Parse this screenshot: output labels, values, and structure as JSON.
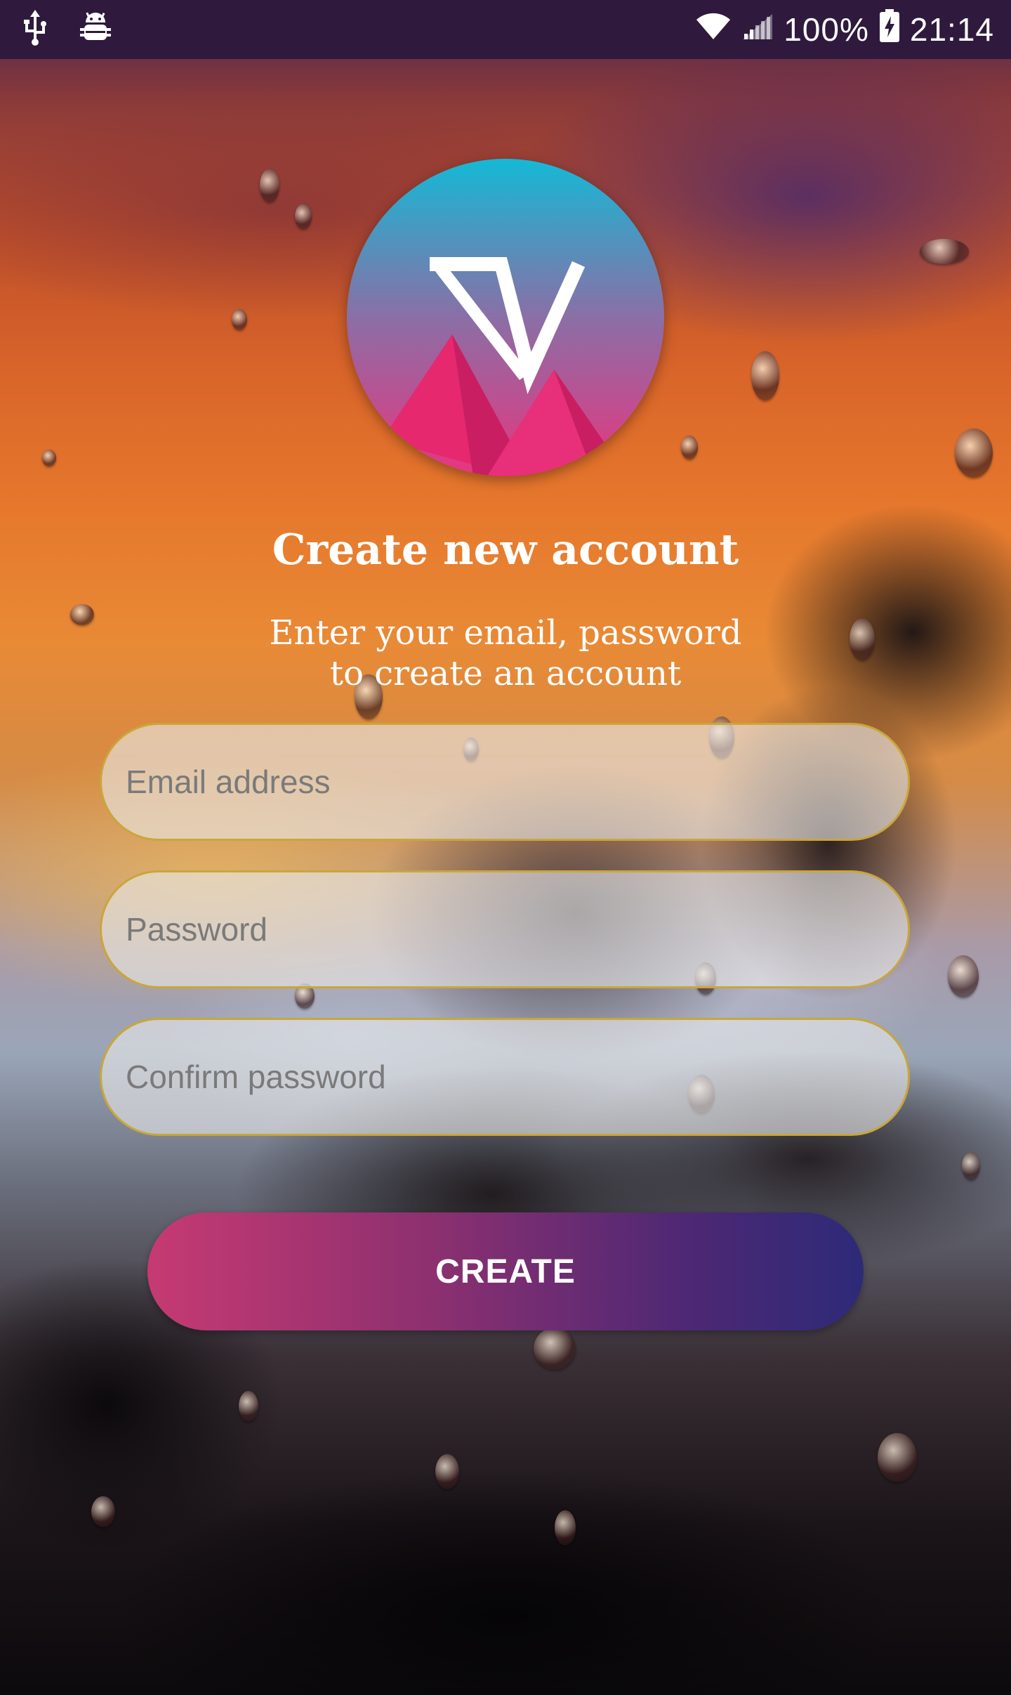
{
  "status_bar": {
    "battery": "100%",
    "time": "21:14",
    "icons": [
      "usb-icon",
      "android-debug-icon",
      "wifi-icon",
      "signal-icon",
      "battery-charging-icon"
    ]
  },
  "logo": {
    "icon": "app-logo-icon",
    "colors": {
      "gradient_top": "#14b9d6",
      "gradient_bottom": "#e8357f",
      "mountain": "#e6286f"
    }
  },
  "header": {
    "title": "Create new account",
    "subtitle_line1": "Enter your email, password",
    "subtitle_line2": "to create an account"
  },
  "form": {
    "email_placeholder": "Email address",
    "password_placeholder": "Password",
    "confirm_placeholder": "Confirm password",
    "field_border_color": "#c9a63a"
  },
  "actions": {
    "create_label": "CREATE",
    "colors": {
      "start": "#c63a72",
      "end": "#2d2a78"
    }
  }
}
